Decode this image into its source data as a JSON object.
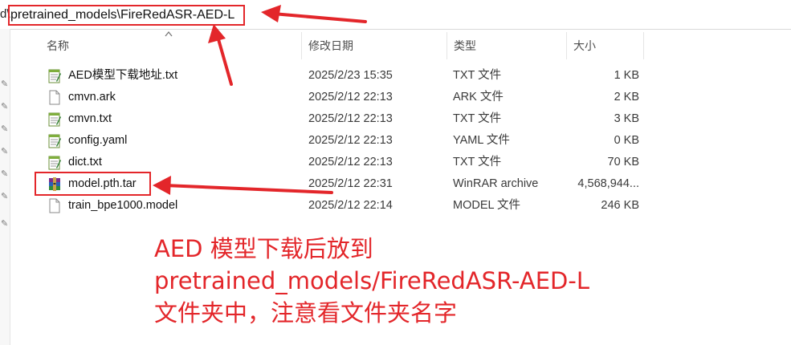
{
  "address_bar": {
    "prefix": "d\\",
    "path": "pretrained_models\\FireRedASR-AED-L"
  },
  "columns": {
    "name": "名称",
    "modified": "修改日期",
    "type": "类型",
    "size": "大小"
  },
  "files": [
    {
      "name": "AED模型下载地址.txt",
      "modified": "2025/2/23 15:35",
      "type": "TXT 文件",
      "size": "1 KB",
      "icon": "notepad-icon"
    },
    {
      "name": "cmvn.ark",
      "modified": "2025/2/12 22:13",
      "type": "ARK 文件",
      "size": "2 KB",
      "icon": "blank-file-icon"
    },
    {
      "name": "cmvn.txt",
      "modified": "2025/2/12 22:13",
      "type": "TXT 文件",
      "size": "3 KB",
      "icon": "notepad-icon"
    },
    {
      "name": "config.yaml",
      "modified": "2025/2/12 22:13",
      "type": "YAML 文件",
      "size": "0 KB",
      "icon": "notepad-icon"
    },
    {
      "name": "dict.txt",
      "modified": "2025/2/12 22:13",
      "type": "TXT 文件",
      "size": "70 KB",
      "icon": "notepad-icon"
    },
    {
      "name": "model.pth.tar",
      "modified": "2025/2/12 22:31",
      "type": "WinRAR archive",
      "size": "4,568,944...",
      "icon": "winrar-icon"
    },
    {
      "name": "train_bpe1000.model",
      "modified": "2025/2/12 22:14",
      "type": "MODEL 文件",
      "size": "246 KB",
      "icon": "blank-file-icon"
    }
  ],
  "annotation": {
    "line1": "AED 模型下载后放到",
    "line2": "pretrained_models/FireRedASR-AED-L",
    "line3": "文件夹中，注意看文件夹名字"
  },
  "colors": {
    "highlight": "#e3262a",
    "header_text": "#4d4d4d"
  }
}
